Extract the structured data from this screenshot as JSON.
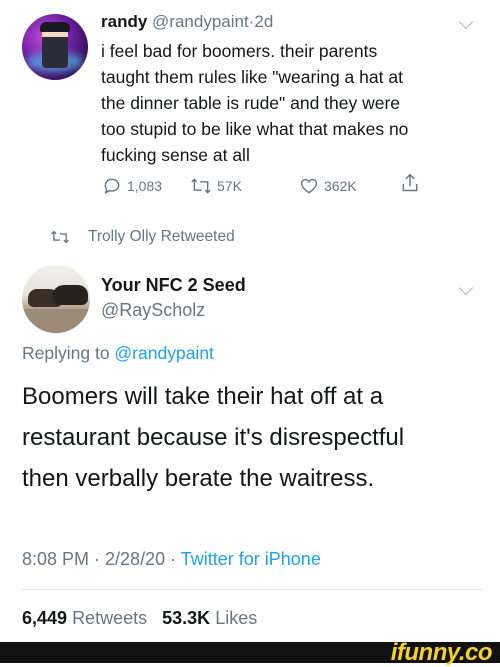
{
  "tweet1": {
    "name": "randy",
    "handle": "@randypaint",
    "sep": "·",
    "time": "2d",
    "lines": [
      "i feel bad for boomers. their parents",
      "taught them rules like \"wearing a hat at",
      "the dinner table is rude\" and they were",
      "too stupid to be like what that makes no",
      "fucking sense at all"
    ],
    "actions": {
      "replies": "1,083",
      "retweets": "57K",
      "likes": "362K"
    }
  },
  "retweeted_by": "Trolly Olly Retweeted",
  "tweet2": {
    "name": "Your NFC 2 Seed",
    "handle": "@RayScholz",
    "replying_prefix": "Replying to ",
    "replying_mention": "@randypaint",
    "lines": [
      "Boomers will take their hat off at a",
      "restaurant because it's disrespectful",
      "then verbally berate the waitress."
    ],
    "meta_time": "8:08 PM · 2/28/20 · ",
    "meta_source": "Twitter for iPhone",
    "retweet_count": "6,449",
    "retweet_label": "Retweets",
    "like_count": "53.3K",
    "like_label": "Likes"
  },
  "watermark": "ifunny.co",
  "colors": {
    "link": "#1da1f2",
    "secondary": "#657786",
    "text": "#14171a",
    "watermark": "#f5d224"
  }
}
